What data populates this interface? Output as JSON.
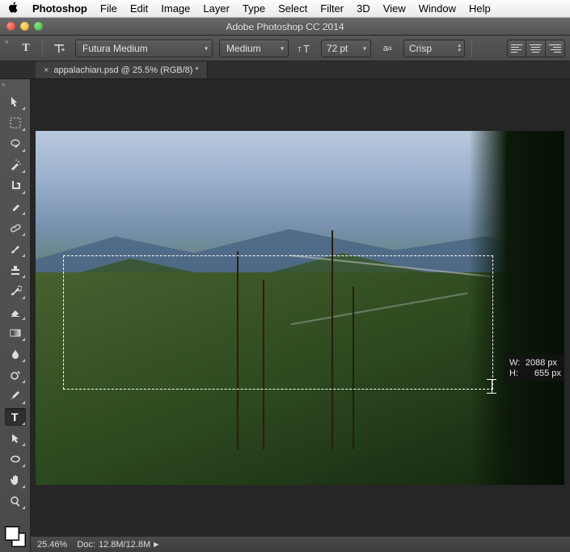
{
  "mac_menu": {
    "app_name": "Photoshop",
    "items": [
      "File",
      "Edit",
      "Image",
      "Layer",
      "Type",
      "Select",
      "Filter",
      "3D",
      "View",
      "Window",
      "Help"
    ]
  },
  "window": {
    "title": "Adobe Photoshop CC 2014"
  },
  "options": {
    "tool_glyph": "T",
    "font_family": "Futura Medium",
    "font_style": "Medium",
    "font_size_value": "72",
    "font_size_unit": "pt",
    "antialias": "Crisp"
  },
  "tab": {
    "label": "appalachian.psd @ 25.5% (RGB/8) *"
  },
  "tools": [
    {
      "name": "move-tool",
      "svg": "move"
    },
    {
      "name": "marquee-tool",
      "svg": "marquee"
    },
    {
      "name": "lasso-tool",
      "svg": "lasso"
    },
    {
      "name": "quick-select-tool",
      "svg": "wand"
    },
    {
      "name": "crop-tool",
      "svg": "crop"
    },
    {
      "name": "eyedropper-tool",
      "svg": "eyedrop"
    },
    {
      "name": "healing-brush-tool",
      "svg": "bandaid"
    },
    {
      "name": "brush-tool",
      "svg": "brush"
    },
    {
      "name": "clone-stamp-tool",
      "svg": "stamp"
    },
    {
      "name": "history-brush-tool",
      "svg": "histbrush"
    },
    {
      "name": "eraser-tool",
      "svg": "eraser"
    },
    {
      "name": "gradient-tool",
      "svg": "gradient"
    },
    {
      "name": "blur-tool",
      "svg": "drop"
    },
    {
      "name": "dodge-tool",
      "svg": "dodge"
    },
    {
      "name": "pen-tool",
      "svg": "pen"
    },
    {
      "name": "type-tool",
      "svg": "type",
      "active": true
    },
    {
      "name": "path-select-tool",
      "svg": "arrow"
    },
    {
      "name": "shape-tool",
      "svg": "ellipseShape"
    },
    {
      "name": "hand-tool",
      "svg": "hand"
    },
    {
      "name": "zoom-tool",
      "svg": "zoom"
    }
  ],
  "selection": {
    "dim_w_label": "W:",
    "dim_w_value": "2088 px",
    "dim_h_label": "H:",
    "dim_h_value": "655 px"
  },
  "status": {
    "zoom": "25.46%",
    "doc_label": "Doc:",
    "doc_value": "12.8M/12.8M"
  }
}
